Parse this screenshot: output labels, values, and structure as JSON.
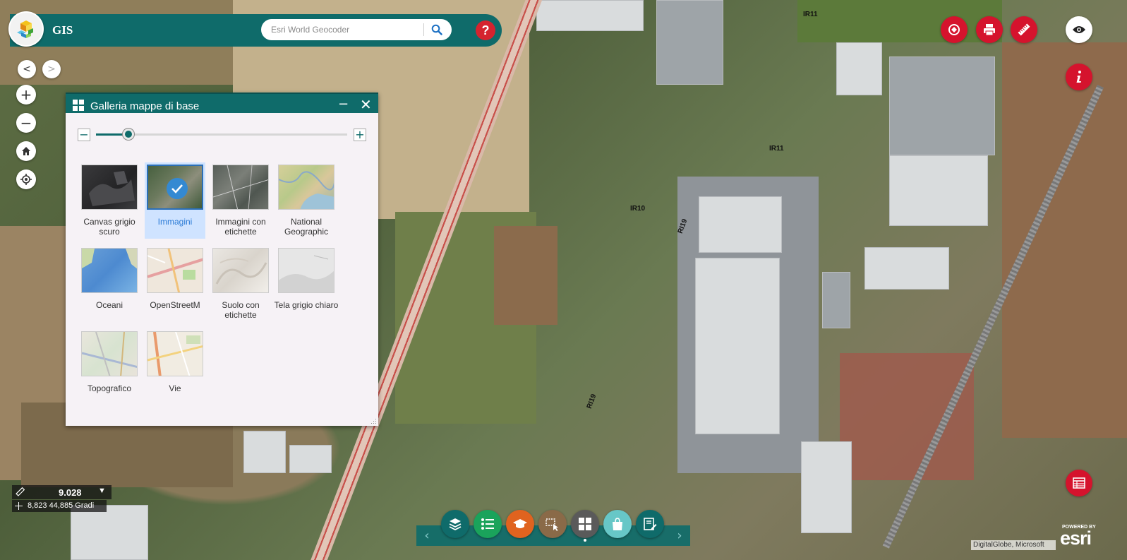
{
  "header": {
    "title": "GIS",
    "search_placeholder": "Esri World Geocoder",
    "help_label": "?"
  },
  "map_nav": {
    "back_label": "<",
    "forward_label": ">",
    "zoom_in_label": "+",
    "zoom_out_label": "−"
  },
  "toolbar_top_right": {
    "icons": [
      "directions-icon",
      "print-icon",
      "measure-icon",
      "eye-icon",
      "info-icon"
    ]
  },
  "basemap_gallery": {
    "title": "Galleria mappe di base",
    "minimize_label": "−",
    "close_label": "✕",
    "zoom_minus_label": "−",
    "zoom_plus_label": "+",
    "slider_value": 0.13,
    "items": [
      {
        "label": "Canvas grigio scuro",
        "selected": false
      },
      {
        "label": "Immagini",
        "selected": true
      },
      {
        "label": "Immagini con etichette",
        "selected": false
      },
      {
        "label": "National Geographic",
        "selected": false
      },
      {
        "label": "Oceani",
        "selected": false
      },
      {
        "label": "OpenStreetM",
        "selected": false
      },
      {
        "label": "Suolo con etichette",
        "selected": false
      },
      {
        "label": "Tela grigio chiaro",
        "selected": false
      },
      {
        "label": "Topografico",
        "selected": false
      },
      {
        "label": "Vie",
        "selected": false
      }
    ]
  },
  "scale": {
    "value": "9.028",
    "coordinates": "8,823 44,885 Gradi"
  },
  "map_labels": {
    "ir11_top": "IR11",
    "ir11_mid": "IR11",
    "ir10": "IR10",
    "ri9_upper": "RI19",
    "ri9_lower": "RI19"
  },
  "dock": {
    "prev_label": "‹",
    "next_label": "›",
    "colors": {
      "layers": "#0f6b6a",
      "legend": "#1aa35b",
      "school": "#e0631f",
      "search": "#8a6a48",
      "gallery": "#5a5a5a",
      "bag": "#67c7c7",
      "edit": "#0f6b6a"
    }
  },
  "attribution": "DigitalGlobe, Microsoft",
  "esri": {
    "powered_by": "POWERED BY",
    "word": "esri"
  },
  "colors": {
    "primary": "#0f6b6a",
    "accent_red": "#d5132d",
    "selected_blue": "#3489d2"
  }
}
